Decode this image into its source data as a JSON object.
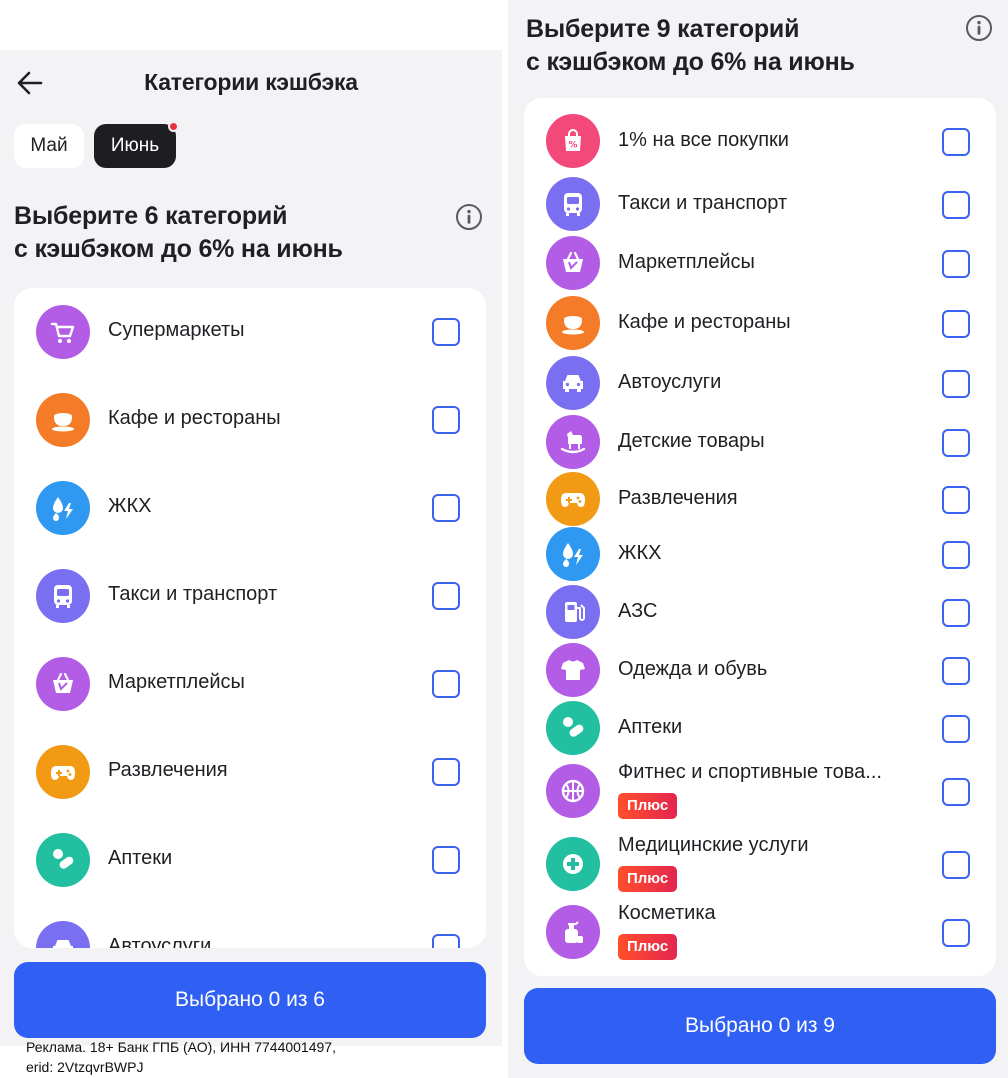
{
  "left": {
    "header": {
      "title": "Категории кэшбэка"
    },
    "tabs": [
      {
        "label": "Май",
        "active": false
      },
      {
        "label": "Июнь",
        "active": true
      }
    ],
    "heading_line1": "Выберите 6 категорий",
    "heading_line2": "с кэшбэком до 6% на июнь",
    "categories": [
      {
        "label": "Супермаркеты",
        "icon": "cart-icon",
        "color": "#b35ce6"
      },
      {
        "label": "Кафе и рестораны",
        "icon": "teacup-icon",
        "color": "#f47c28"
      },
      {
        "label": "ЖКХ",
        "icon": "utilities-icon",
        "color": "#2f98f0"
      },
      {
        "label": "Такси и транспорт",
        "icon": "bus-icon",
        "color": "#7a6ff0"
      },
      {
        "label": "Маркетплейсы",
        "icon": "basket-icon",
        "color": "#b35ce6"
      },
      {
        "label": "Развлечения",
        "icon": "gamepad-icon",
        "color": "#f29a14"
      },
      {
        "label": "Аптеки",
        "icon": "pill-icon",
        "color": "#22bfa0"
      },
      {
        "label": "Автоуслуги",
        "icon": "car-icon",
        "color": "#7a6ff0"
      }
    ],
    "button_label": "Выбрано 0 из 6",
    "selected": 0,
    "max": 6
  },
  "ad": {
    "line1": "Реклама. 18+ Банк ГПБ (АО), ИНН 7744001497,",
    "line2": "erid: 2VtzqvrBWPJ"
  },
  "right": {
    "heading_line1": "Выберите 9 категорий",
    "heading_line2": "с кэшбэком до 6% на июнь",
    "categories": [
      {
        "label": "1% на все покупки",
        "icon": "percent-bag-icon",
        "color": "#f2487a"
      },
      {
        "label": "Такси и транспорт",
        "icon": "bus-icon",
        "color": "#7a6ff0"
      },
      {
        "label": "Маркетплейсы",
        "icon": "basket-icon",
        "color": "#b35ce6"
      },
      {
        "label": "Кафе и рестораны",
        "icon": "teacup-icon",
        "color": "#f47c28"
      },
      {
        "label": "Автоуслуги",
        "icon": "car-icon",
        "color": "#7a6ff0"
      },
      {
        "label": "Детские товары",
        "icon": "rocking-horse-icon",
        "color": "#b35ce6"
      },
      {
        "label": "Развлечения",
        "icon": "gamepad-icon",
        "color": "#f29a14"
      },
      {
        "label": "ЖКХ",
        "icon": "utilities-icon",
        "color": "#2f98f0"
      },
      {
        "label": "АЗС",
        "icon": "fuel-icon",
        "color": "#7a6ff0"
      },
      {
        "label": "Одежда и обувь",
        "icon": "tshirt-icon",
        "color": "#b35ce6"
      },
      {
        "label": "Аптеки",
        "icon": "pill-icon",
        "color": "#22bfa0"
      },
      {
        "label": "Фитнес и спортивные това...",
        "icon": "ball-icon",
        "color": "#b35ce6",
        "badge": "Плюс"
      },
      {
        "label": "Медицинские услуги",
        "icon": "medical-cross-icon",
        "color": "#22bfa0",
        "badge": "Плюс"
      },
      {
        "label": "Косметика",
        "icon": "cosmetics-icon",
        "color": "#b35ce6",
        "badge": "Плюс"
      }
    ],
    "button_label": "Выбрано 0 из 9",
    "selected": 0,
    "max": 9
  }
}
